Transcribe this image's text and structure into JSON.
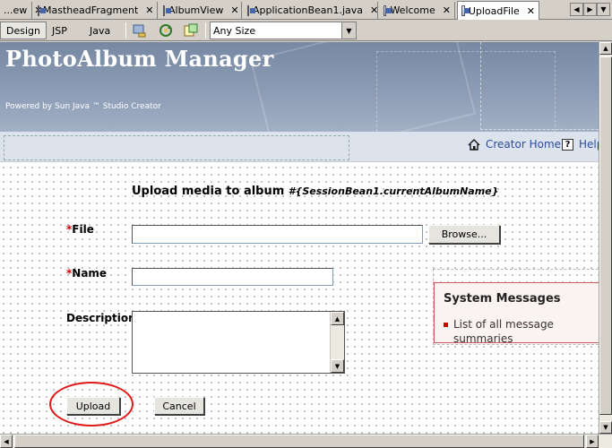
{
  "tabs": [
    {
      "label": "...ew",
      "closable": true
    },
    {
      "label": "MastheadFragment",
      "closable": true
    },
    {
      "label": "AlbumView",
      "closable": true
    },
    {
      "label": "ApplicationBean1.java",
      "closable": true
    },
    {
      "label": "Welcome",
      "closable": true
    },
    {
      "label": "UploadFile",
      "closable": true,
      "active": true
    }
  ],
  "tab_nav": {
    "left": "◀",
    "right": "▶",
    "list": "▼"
  },
  "toolbar": {
    "design": "Design",
    "jsp": "JSP",
    "java": "Java",
    "icons": [
      "refresh-icon",
      "sync-icon",
      "preview-icon"
    ],
    "size_select": "Any Size"
  },
  "masthead": {
    "title": "PhotoAlbum Manager",
    "powered_by": "Powered by Sun Java ™ Studio Creator"
  },
  "nav": {
    "home": "Creator Home",
    "help_icon": "?",
    "help": "Help"
  },
  "form": {
    "heading": "Upload media to album",
    "heading_expr": "#{SessionBean1.currentAlbumName}",
    "required_marker": "*",
    "file_label": "File",
    "browse": "Browse...",
    "name_label": "Name",
    "description_label": "Description",
    "upload": "Upload",
    "cancel": "Cancel"
  },
  "messages": {
    "title": "System Messages",
    "items": [
      "List of all message summaries"
    ]
  },
  "colors": {
    "masthead": "#8c9cb5",
    "link": "#2c4c9c",
    "required": "#cc0000",
    "message_border": "#cc5a5a",
    "annotation_circle": "#e01818"
  }
}
